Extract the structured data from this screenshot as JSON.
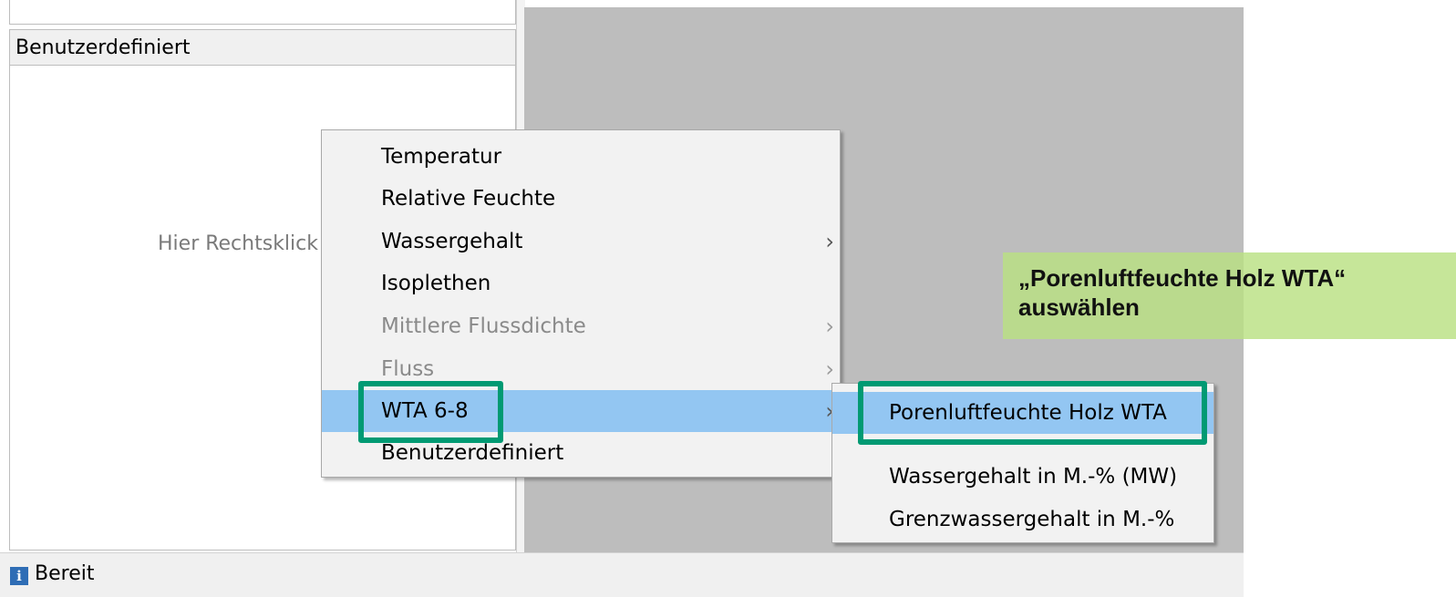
{
  "panel": {
    "header": "Benutzerdefiniert",
    "hint": "Hier Rechtsklick"
  },
  "status": {
    "icon": "info-icon",
    "text": "Bereit"
  },
  "context_menu": {
    "items": [
      {
        "label": "Temperatur",
        "enabled": true,
        "submenu": false
      },
      {
        "label": "Relative Feuchte",
        "enabled": true,
        "submenu": false
      },
      {
        "label": "Wassergehalt",
        "enabled": true,
        "submenu": true
      },
      {
        "label": "Isoplethen",
        "enabled": true,
        "submenu": false
      },
      {
        "label": "Mittlere Flussdichte",
        "enabled": false,
        "submenu": true
      },
      {
        "label": "Fluss",
        "enabled": false,
        "submenu": true
      },
      {
        "label": "WTA 6-8",
        "enabled": true,
        "submenu": true,
        "highlighted": true
      },
      {
        "label": "Benutzerdefiniert",
        "enabled": true,
        "submenu": false
      }
    ],
    "chevron": "›"
  },
  "submenu": {
    "items": [
      {
        "label": "Porenluftfeuchte Holz WTA",
        "highlighted": true
      },
      {
        "label": "Wassergehalt in M.-% (MW)"
      },
      {
        "label": "Grenzwassergehalt in M.-%"
      }
    ]
  },
  "callout": {
    "line1": "„Porenluftfeuchte Holz WTA“",
    "line2": "auswählen"
  },
  "colors": {
    "highlight": "#93c6f2",
    "frame": "#009a73",
    "callout": "#b9e182",
    "gray_area": "#bdbdbd"
  }
}
